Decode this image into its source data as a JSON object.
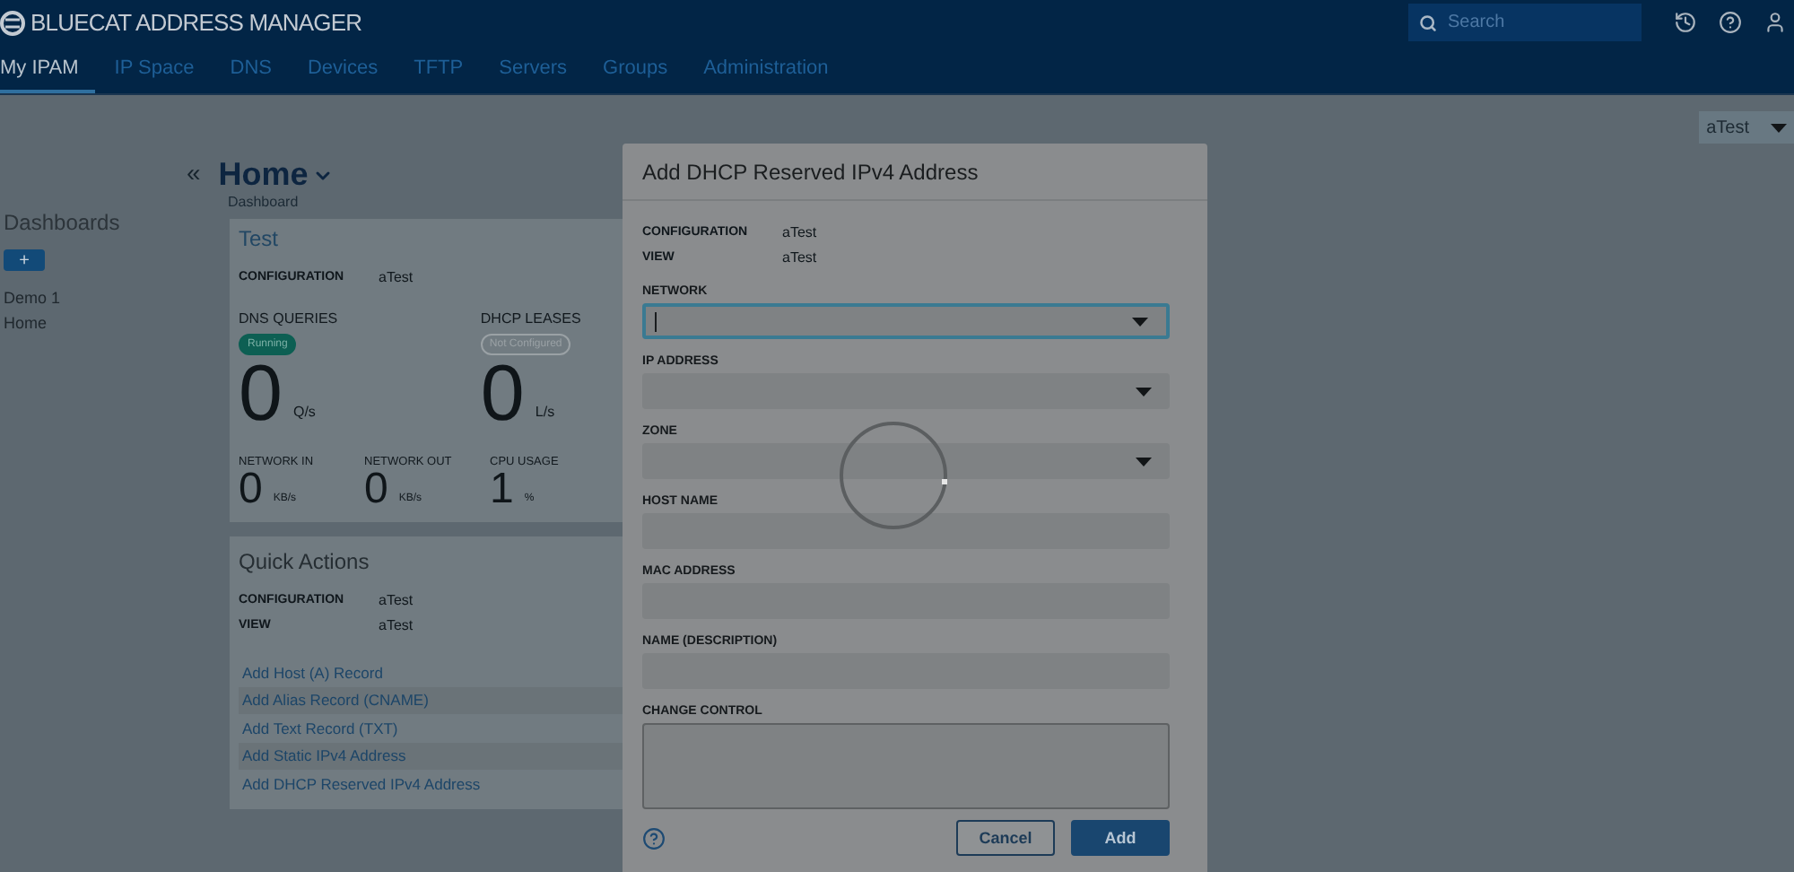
{
  "header": {
    "brand": "BLUECAT ADDRESS MANAGER",
    "search": {
      "placeholder": "Search"
    }
  },
  "nav": [
    {
      "label": "My IPAM",
      "selected": true
    },
    {
      "label": "IP Space",
      "selected": false
    },
    {
      "label": "DNS",
      "selected": false
    },
    {
      "label": "Devices",
      "selected": false
    },
    {
      "label": "TFTP",
      "selected": false
    },
    {
      "label": "Servers",
      "selected": false
    },
    {
      "label": "Groups",
      "selected": false
    },
    {
      "label": "Administration",
      "selected": false
    }
  ],
  "config_select": "aTest",
  "sidebar": {
    "title": "Dashboards",
    "add": "+",
    "items": [
      {
        "label": "Demo 1"
      },
      {
        "label": "Home"
      }
    ]
  },
  "page": {
    "collapse": "«",
    "title": "Home",
    "subtitle": "Dashboard"
  },
  "test_card": {
    "title": "Test",
    "config_label": "CONFIGURATION",
    "config_value": "aTest",
    "stats": [
      {
        "label": "DNS QUERIES",
        "status": "Running",
        "running": true,
        "value": "0",
        "unit": "Q/s"
      },
      {
        "label": "DHCP LEASES",
        "status": "Not Configured",
        "running": false,
        "value": "0",
        "unit": "L/s"
      }
    ],
    "metrics": [
      {
        "label": "NETWORK IN",
        "value": "0",
        "unit": "KB/s"
      },
      {
        "label": "NETWORK OUT",
        "value": "0",
        "unit": "KB/s"
      },
      {
        "label": "CPU USAGE",
        "value": "1",
        "unit": "%"
      }
    ]
  },
  "quick_actions": {
    "title": "Quick Actions",
    "props": [
      {
        "label": "CONFIGURATION",
        "value": "aTest"
      },
      {
        "label": "VIEW",
        "value": "aTest"
      }
    ],
    "links": [
      "Add Host (A) Record",
      "Add Alias Record (CNAME)",
      "Add Text Record (TXT)",
      "Add Static IPv4 Address",
      "Add DHCP Reserved IPv4 Address"
    ]
  },
  "dialog": {
    "title": "Add DHCP Reserved IPv4 Address",
    "props": [
      {
        "label": "CONFIGURATION",
        "value": "aTest"
      },
      {
        "label": "VIEW",
        "value": "aTest"
      }
    ],
    "fields": [
      {
        "label": "NETWORK",
        "kind": "select",
        "focused": true
      },
      {
        "label": "IP ADDRESS",
        "kind": "select",
        "focused": false
      },
      {
        "label": "ZONE",
        "kind": "select",
        "focused": false
      },
      {
        "label": "HOST NAME",
        "kind": "text",
        "focused": false
      },
      {
        "label": "MAC ADDRESS",
        "kind": "text",
        "focused": false
      },
      {
        "label": "NAME (DESCRIPTION)",
        "kind": "text",
        "focused": false
      },
      {
        "label": "CHANGE CONTROL",
        "kind": "textarea",
        "focused": false
      }
    ],
    "loading": true,
    "buttons": [
      {
        "label": "Cancel",
        "primary": false
      },
      {
        "label": "Add",
        "primary": true
      }
    ]
  }
}
